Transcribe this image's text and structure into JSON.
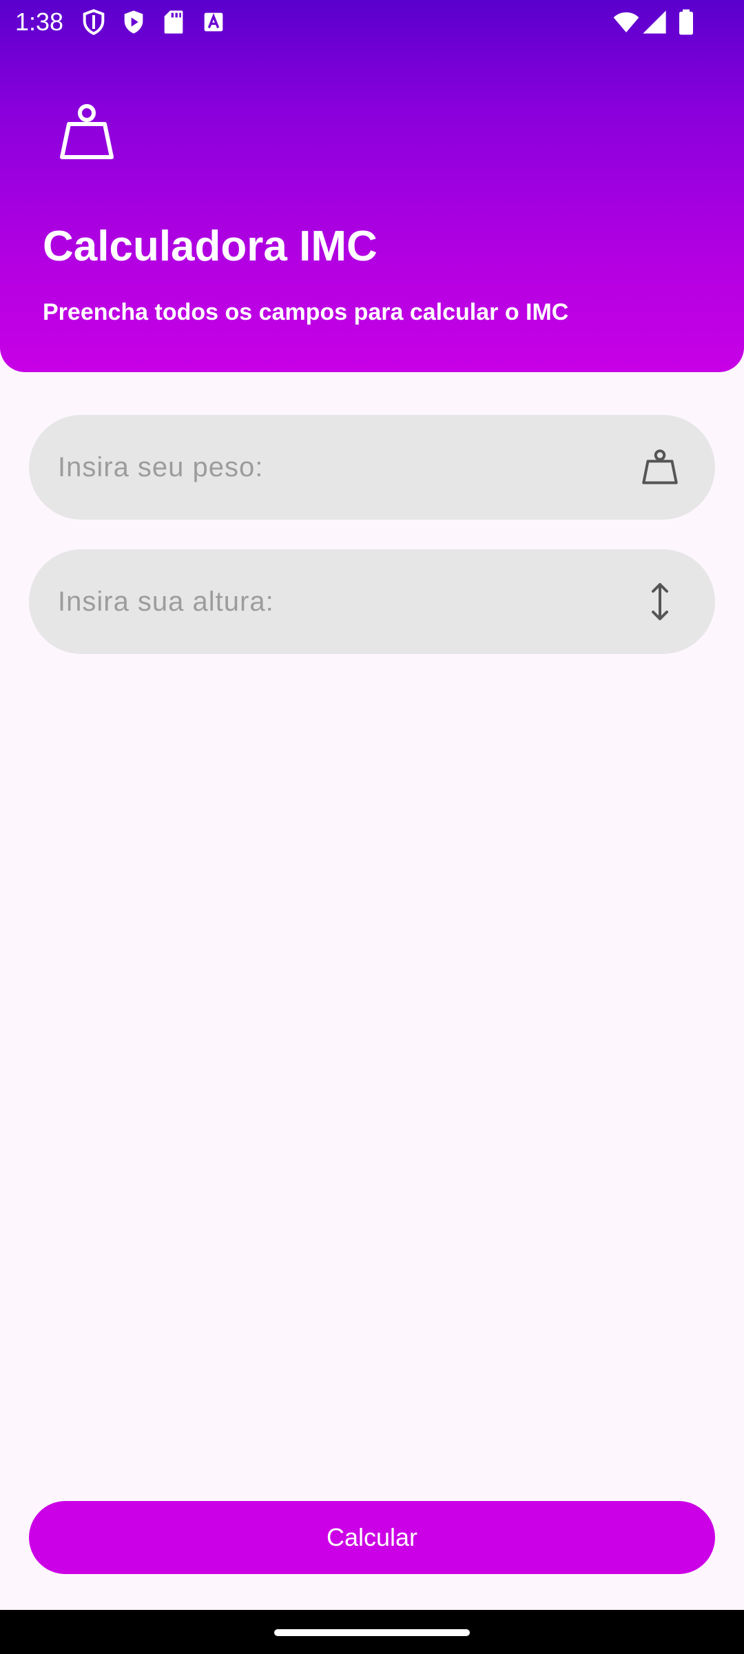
{
  "status_bar": {
    "time": "1:38",
    "left_icons": [
      "shield-outline-icon",
      "shield-play-icon",
      "sd-card-icon",
      "font-a-icon"
    ],
    "right_icons": [
      "wifi-icon",
      "signal-icon",
      "battery-icon"
    ]
  },
  "header": {
    "icon": "weight-icon",
    "title": "Calculadora IMC",
    "subtitle": "Preencha todos os campos para calcular o IMC"
  },
  "form": {
    "weight": {
      "value": "",
      "placeholder": "Insira seu peso:",
      "icon": "weight-icon"
    },
    "height": {
      "value": "",
      "placeholder": "Insira sua altura:",
      "icon": "vertical-arrows-icon"
    }
  },
  "actions": {
    "calculate_label": "Calcular"
  },
  "colors": {
    "header_gradient_top": "#5a00cd",
    "header_gradient_bottom": "#c800e6",
    "button": "#cc00e6",
    "field_background": "#e6e6e6",
    "page_background": "#fdf7fd"
  }
}
